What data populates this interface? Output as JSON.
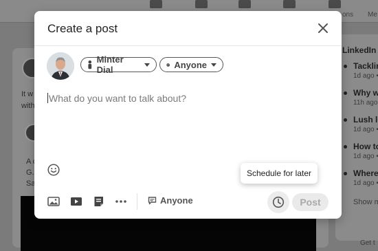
{
  "background": {
    "nav_labels": [
      "ons",
      "Me"
    ],
    "sidebar_title": "LinkedIn",
    "sidebar_items": [
      {
        "title": "Tacklin",
        "meta": "1d ago •"
      },
      {
        "title": "Why w",
        "meta": "11h ago"
      },
      {
        "title": "Lush le",
        "meta": "1d ago •"
      },
      {
        "title": "How to",
        "meta": "1d ago •"
      },
      {
        "title": "Where",
        "meta": "1d ago •"
      }
    ],
    "sidebar_more": "Show m",
    "feed_text_1": "It w",
    "feed_text_2": "with",
    "feed_text_3": "A c",
    "feed_text_4": "G.",
    "feed_text_5": "Sa",
    "footer_text": "Get t"
  },
  "modal": {
    "title": "Create a post",
    "author_name": "Minter Dial",
    "visibility": "Anyone",
    "placeholder": "What do you want to talk about?",
    "tooltip": "Schedule for later",
    "comment_control": "Anyone",
    "post_button": "Post"
  },
  "colors": {
    "overlay": "#7b7b7b",
    "post_disabled_bg": "#eaeaea",
    "post_disabled_text": "#a9a9a9"
  },
  "icons": [
    "home-icon",
    "network-icon",
    "jobs-icon",
    "messaging-icon",
    "notifications-icon",
    "close-icon",
    "person-icon",
    "globe-icon",
    "emoji-icon",
    "photo-icon",
    "video-icon",
    "document-icon",
    "more-icon",
    "comment-icon",
    "clock-icon"
  ]
}
